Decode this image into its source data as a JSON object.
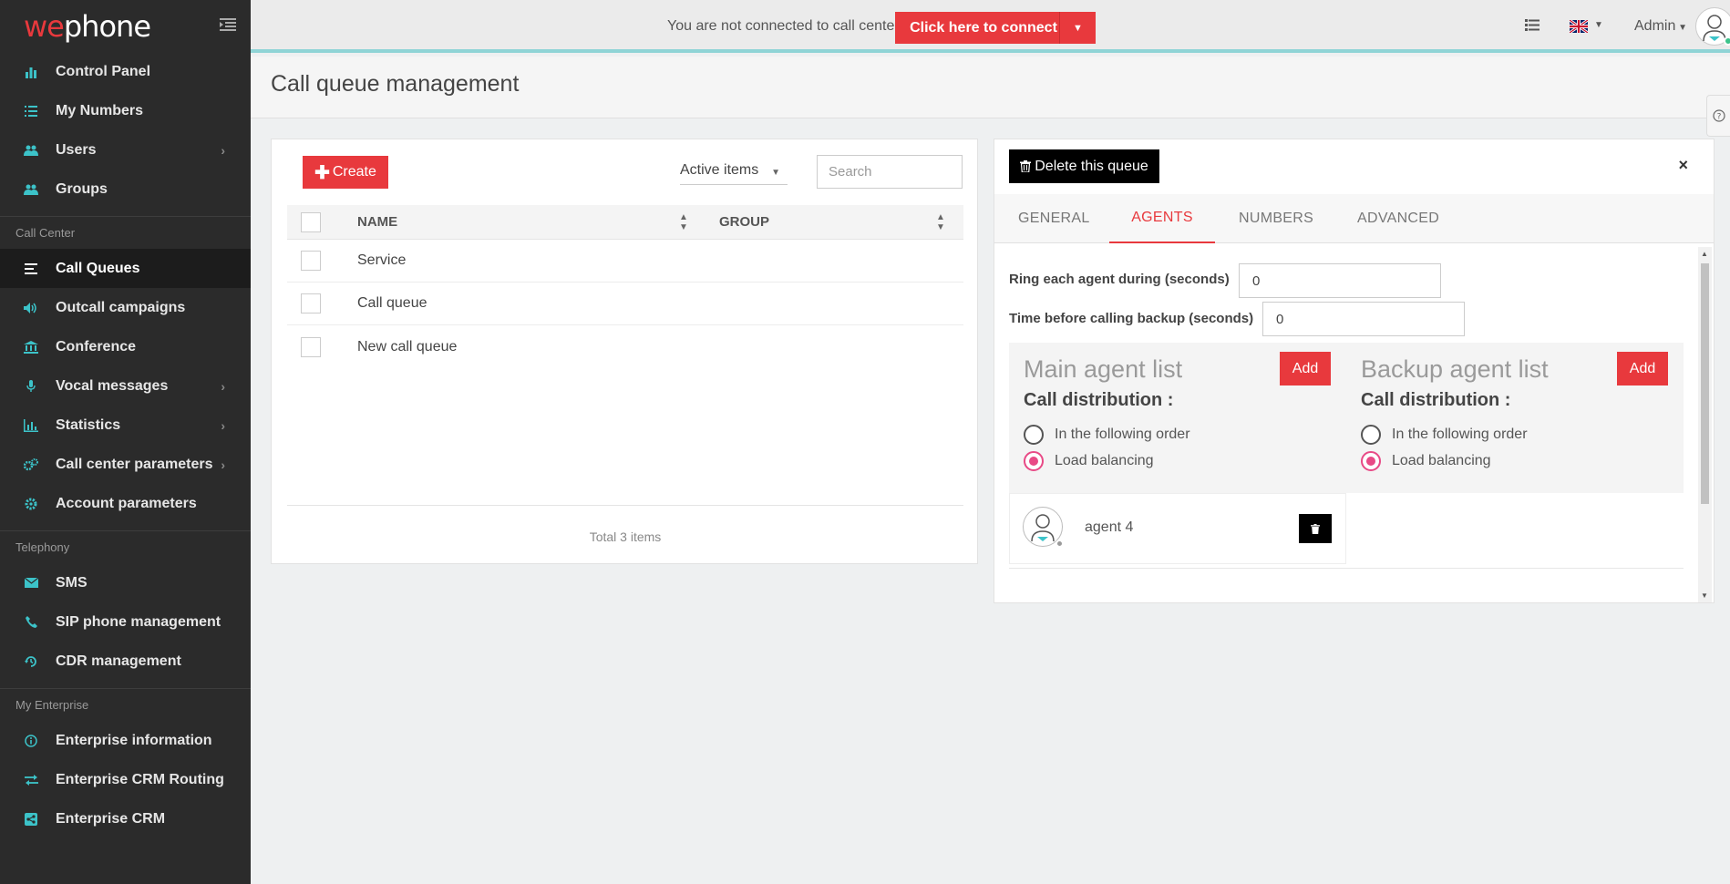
{
  "brand": {
    "logo_we": "we",
    "logo_phone": "phone"
  },
  "sidebar": {
    "items_top": [
      {
        "label": "Control Panel",
        "icon": "bar-chart-icon"
      },
      {
        "label": "My Numbers",
        "icon": "list-icon"
      },
      {
        "label": "Users",
        "icon": "users-icon",
        "has_submenu": true
      },
      {
        "label": "Groups",
        "icon": "groups-icon"
      }
    ],
    "section_call_center": "Call Center",
    "items_call_center": [
      {
        "label": "Call Queues",
        "icon": "queue-icon",
        "active": true
      },
      {
        "label": "Outcall campaigns",
        "icon": "volume-icon"
      },
      {
        "label": "Conference",
        "icon": "institution-icon"
      },
      {
        "label": "Vocal messages",
        "icon": "microphone-icon",
        "has_submenu": true
      },
      {
        "label": "Statistics",
        "icon": "statistics-icon",
        "has_submenu": true
      },
      {
        "label": "Call center parameters",
        "icon": "cogs-icon",
        "has_submenu": true
      },
      {
        "label": "Account parameters",
        "icon": "gear-icon"
      }
    ],
    "section_telephony": "Telephony",
    "items_telephony": [
      {
        "label": "SMS",
        "icon": "envelope-icon"
      },
      {
        "label": "SIP phone management",
        "icon": "phone-icon"
      },
      {
        "label": "CDR management",
        "icon": "history-icon"
      }
    ],
    "section_enterprise": "My Enterprise",
    "items_enterprise": [
      {
        "label": "Enterprise information",
        "icon": "info-icon"
      },
      {
        "label": "Enterprise CRM Routing",
        "icon": "exchange-icon"
      },
      {
        "label": "Enterprise CRM",
        "icon": "share-icon"
      }
    ]
  },
  "topbar": {
    "connection_status": "You are not connected to call center",
    "connect_button": "Click here to connect",
    "user_menu": "Admin"
  },
  "page": {
    "title": "Call queue management"
  },
  "queue_list": {
    "create_label": "Create",
    "filter_selected": "Active items",
    "search_placeholder": "Search",
    "columns": {
      "name": "NAME",
      "group": "GROUP"
    },
    "rows": [
      {
        "name": "Service",
        "group": ""
      },
      {
        "name": "Call queue",
        "group": ""
      },
      {
        "name": "New call queue",
        "group": ""
      }
    ],
    "footer": "Total 3 items"
  },
  "queue_detail": {
    "delete_label": "Delete this queue",
    "close_label": "×",
    "tabs": [
      "GENERAL",
      "AGENTS",
      "NUMBERS",
      "ADVANCED"
    ],
    "active_tab": "AGENTS",
    "ring_label": "Ring each agent during (seconds)",
    "ring_value": "0",
    "backup_time_label": "Time before calling backup (seconds)",
    "backup_time_value": "0",
    "main_list": {
      "title": "Main agent list",
      "add_label": "Add",
      "distribution_label": "Call distribution :",
      "option_order": "In the following order",
      "option_balancing": "Load balancing",
      "selected": "Load balancing"
    },
    "backup_list": {
      "title": "Backup agent list",
      "add_label": "Add",
      "distribution_label": "Call distribution :",
      "option_order": "In the following order",
      "option_balancing": "Load balancing",
      "selected": "Load balancing"
    },
    "main_agents": [
      {
        "name": "agent 4"
      }
    ]
  },
  "colors": {
    "accent": "#e8393d",
    "sidebar_bg": "#2b2b2b",
    "icon_teal": "#3cc3c9",
    "radio_pink": "#e84a86"
  }
}
